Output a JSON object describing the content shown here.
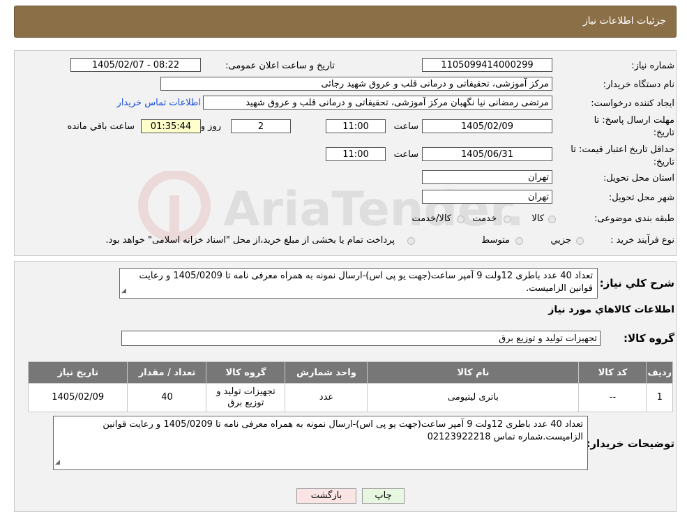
{
  "header": {
    "title": "جزئیات اطلاعات نیاز"
  },
  "watermark": {
    "text": "AriaTender.neT"
  },
  "form": {
    "need_number_label": "شماره نیاز:",
    "need_number": "1105099414000299",
    "announce_label": "تاریخ و ساعت اعلان عمومی:",
    "announce_value": "1405/02/07 - 08:22",
    "buyer_label": "نام دستگاه خریدار:",
    "buyer_value": "مرکز آموزشی، تحقیقاتی و درمانی قلب و عروق شهید رجائی",
    "creator_label": "ایجاد کننده درخواست:",
    "creator_value": "مرتضی رمضانی نیا نگهبان مرکز آموزشی، تحقیقاتی و درمانی قلب و عروق شهید",
    "contact_link": "اطلاعات تماس خریدار",
    "deadline_label_1": "مهلت ارسال پاسخ: تا",
    "deadline_label_2": "تاریخ:",
    "deadline_date": "1405/02/09",
    "time_label": "ساعت",
    "deadline_time": "11:00",
    "days_value": "2",
    "days_label": "روز و",
    "remaining_value": "01:35:44",
    "remaining_label": "ساعت باقي مانده",
    "validity_label_1": "حداقل تاریخ اعتبار قیمت: تا",
    "validity_label_2": "تاریخ:",
    "validity_date": "1405/06/31",
    "validity_time": "11:00",
    "province_label": "استان محل تحویل:",
    "province_value": "تهران",
    "city_label": "شهر محل تحویل:",
    "city_value": "تهران",
    "category_label": "طبقه بندی موضوعی:",
    "category_options": [
      "کالا",
      "خدمت",
      "کالا/خدمت"
    ],
    "process_label": "نوع فرآیند خرید :",
    "process_options": [
      "جزیي",
      "متوسط"
    ],
    "process_note": "پرداخت تمام یا بخشی از مبلغ خرید،از محل \"اسناد خزانه اسلامی\" خواهد بود."
  },
  "summary": {
    "label": "شرح کلي نياز:",
    "text": "تعداد  40 عدد باطری 12ولت  9 آمپر ساعت(جهت یو پی اس)-ارسال نمونه به همراه معرفی نامه تا 1405/0209 و رعایت قوانین الزامیست.",
    "items_heading": "اطلاعات کالاهاي مورد نياز",
    "group_label": "گروه کالا:",
    "group_value": "تجهیزات تولید و توزیع برق"
  },
  "table": {
    "headers": [
      "رديف",
      "کد کالا",
      "نام کالا",
      "واحد شمارش",
      "گروه کالا",
      "تعداد / مقدار",
      "تاريخ نياز"
    ],
    "rows": [
      [
        "1",
        "--",
        "باتری لیتیومی",
        "عدد",
        "تجهیزات تولید و توزیع برق",
        "40",
        "1405/02/09"
      ]
    ]
  },
  "buyer_notes": {
    "label": "توضيحات خريدار:",
    "text": "تعداد  40 عدد باطری 12ولت  9 آمپر ساعت(جهت یو پی اس)-ارسال نمونه به همراه معرفی نامه تا 1405/0209 و رعایت قوانین الزامیست.شماره تماس 02123922218"
  },
  "buttons": {
    "print": "چاپ",
    "back": "بازگشت"
  }
}
